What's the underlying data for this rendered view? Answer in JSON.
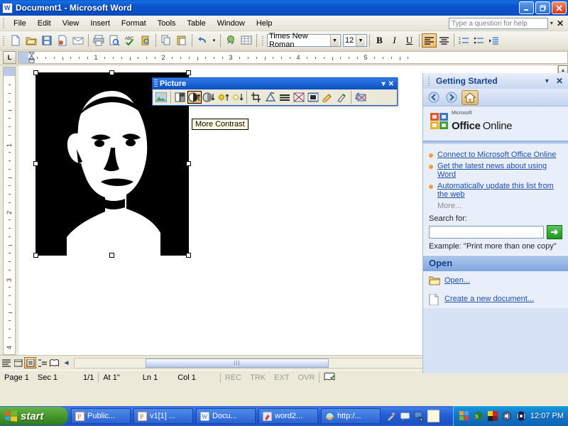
{
  "window": {
    "title": "Document1 - Microsoft Word",
    "icon": "word-document-icon",
    "minimize": "_",
    "maximize": "❐",
    "close": "✕"
  },
  "menubar": {
    "items": [
      "File",
      "Edit",
      "View",
      "Insert",
      "Format",
      "Tools",
      "Table",
      "Window",
      "Help"
    ],
    "help_placeholder": "Type a question for help",
    "help_value": "",
    "caret": "▾",
    "close": "✕"
  },
  "toolbar": {
    "buttons": [
      {
        "name": "new-document",
        "glyph": "🗋"
      },
      {
        "name": "open",
        "glyph": "📂"
      },
      {
        "name": "save",
        "glyph": "💾"
      },
      {
        "name": "permission",
        "glyph": "🔏"
      },
      {
        "name": "email",
        "glyph": "✉"
      },
      {
        "name": "print",
        "glyph": "🖶"
      },
      {
        "name": "print-preview",
        "glyph": "🔍"
      },
      {
        "name": "spelling-grammar",
        "glyph": "ABC"
      },
      {
        "name": "research",
        "glyph": "📕"
      },
      {
        "name": "copy",
        "glyph": "⧉"
      },
      {
        "name": "paste",
        "glyph": "📋"
      },
      {
        "name": "undo",
        "glyph": "↺"
      },
      {
        "name": "undo-dropdown",
        "glyph": "▾"
      },
      {
        "name": "insert-hyperlink",
        "glyph": "🌐"
      },
      {
        "name": "insert-table",
        "glyph": "▦"
      }
    ],
    "font_name": "Times New Roman",
    "font_size": "12",
    "bold": "B",
    "italic": "I",
    "underline": "U",
    "align_left": "≡",
    "align_center": "≡",
    "numbering": "⒈",
    "bullets": "•≡",
    "indent": "⇥"
  },
  "ruler": {
    "tab_selector": "L",
    "h_numbers": [
      "1",
      "2",
      "3",
      "4",
      "5"
    ],
    "v_numbers": [
      "1",
      "2",
      "3",
      "4"
    ]
  },
  "picture_toolbar": {
    "title": "Picture",
    "dropdown": "▾",
    "close": "✕",
    "buttons": [
      {
        "name": "insert-picture-icon",
        "active": false
      },
      {
        "name": "color-icon",
        "active": false
      },
      {
        "name": "more-contrast-icon",
        "active": true
      },
      {
        "name": "less-contrast-icon",
        "active": false
      },
      {
        "name": "more-brightness-icon",
        "active": false
      },
      {
        "name": "less-brightness-icon",
        "active": false
      },
      {
        "name": "crop-icon",
        "active": false
      },
      {
        "name": "rotate-left-icon",
        "active": false
      },
      {
        "name": "line-style-icon",
        "active": false
      },
      {
        "name": "compress-pictures-icon",
        "active": false
      },
      {
        "name": "text-wrapping-icon",
        "active": false
      },
      {
        "name": "format-picture-icon",
        "active": false
      },
      {
        "name": "set-transparent-color-icon",
        "active": false
      },
      {
        "name": "reset-picture-icon",
        "active": false
      }
    ],
    "tooltip": "More Contrast"
  },
  "document": {
    "image_alt": "high-contrast black and white portrait photograph",
    "selected": true
  },
  "task_pane": {
    "title": "Getting Started",
    "dropdown": "▾",
    "close": "✕",
    "nav": {
      "back": "◄",
      "forward": "►",
      "home": "⌂"
    },
    "logo": {
      "microsoft": "Microsoft",
      "office": "Office",
      "online": "Online"
    },
    "links": [
      "Connect to Microsoft Office Online",
      "Get the latest news about using Word",
      "Automatically update this list from the web"
    ],
    "more": "More...",
    "search_label": "Search for:",
    "search_value": "",
    "go": "➜",
    "example": "Example:  \"Print more than one copy\"",
    "open_header": "Open",
    "open_items": [
      {
        "label": "Open...",
        "icon": "open-folder-icon"
      },
      {
        "label": "Create a new document...",
        "icon": "new-document-icon"
      }
    ]
  },
  "view_bar": {
    "buttons": [
      {
        "name": "normal-view",
        "glyph": "≣",
        "active": false
      },
      {
        "name": "web-layout-view",
        "glyph": "🗔",
        "active": false
      },
      {
        "name": "print-layout-view",
        "glyph": "▤",
        "active": true
      },
      {
        "name": "outline-view",
        "glyph": "⊞",
        "active": false
      },
      {
        "name": "reading-layout-view",
        "glyph": "📖",
        "active": false
      }
    ],
    "left_arrow": "◄",
    "right_arrow": "►"
  },
  "status_bar": {
    "page": "Page  1",
    "sec": "Sec  1",
    "pages": "1/1",
    "at": "At  1\"",
    "line": "Ln  1",
    "col": "Col  1",
    "rec": "REC",
    "trk": "TRK",
    "ext": "EXT",
    "ovr": "OVR",
    "spell_icon": "spelling-status-icon"
  },
  "taskbar": {
    "start": "start",
    "items": [
      {
        "label": "Public...",
        "icon": "powerpoint-icon"
      },
      {
        "label": "v1[1] ...",
        "icon": "powerpoint-icon"
      },
      {
        "label": "Docu...",
        "icon": "word-icon"
      },
      {
        "label": "word2...",
        "icon": "paint-icon"
      },
      {
        "label": "http:/...",
        "icon": "internet-explorer-icon"
      }
    ],
    "quick_launch": [
      {
        "name": "media-icon",
        "glyph": "🎤"
      },
      {
        "name": "messenger-icon",
        "glyph": "💬"
      },
      {
        "name": "show-desktop-icon",
        "glyph": "🖱"
      },
      {
        "name": "blank-window-icon",
        "glyph": ""
      }
    ],
    "tray": [
      {
        "name": "windows-update-icon",
        "glyph": "⊞"
      },
      {
        "name": "antivirus-icon",
        "glyph": "✹"
      },
      {
        "name": "display-icon",
        "glyph": "▦"
      },
      {
        "name": "volume-icon",
        "glyph": "◕"
      },
      {
        "name": "network-icon",
        "glyph": "◉"
      }
    ],
    "clock": "12:07 PM"
  }
}
